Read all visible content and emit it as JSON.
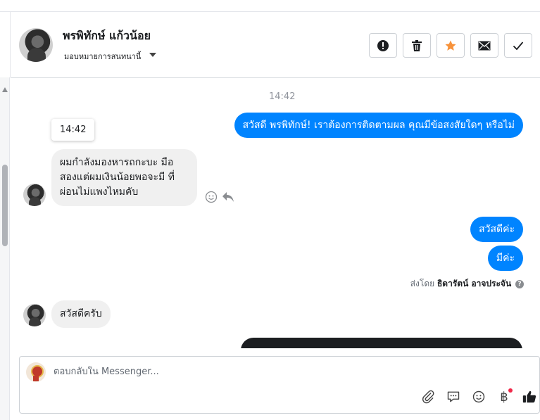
{
  "header": {
    "contact_name": "พรพิทักษ์ แก้วน้อย",
    "assign_label": "มอบหมายการสนทนานี้",
    "buttons": [
      {
        "name": "spam-button",
        "icon": "exclamation-circle-icon"
      },
      {
        "name": "delete-button",
        "icon": "trash-icon"
      },
      {
        "name": "star-button",
        "icon": "star-icon",
        "color": "#f7923b"
      },
      {
        "name": "mark-unread-button",
        "icon": "envelope-icon"
      },
      {
        "name": "mark-done-button",
        "icon": "checkmark-icon"
      }
    ]
  },
  "chat": {
    "timestamp": "14:42",
    "hover_tooltip": "14:42",
    "messages": [
      {
        "from": "page",
        "text": "สวัสดี พรพิทักษ์! เราต้องการติดตามผล คุณมีข้อสงสัยใดๆ หรือไม่"
      },
      {
        "from": "user",
        "text": "ผมกำลังมองหารถกะบะ มือสองแต่ผมเงินน้อยพอจะมี ที่ผ่อนไม่แพงไหมคับ"
      },
      {
        "from": "page",
        "text": "สวัสดีค่ะ"
      },
      {
        "from": "page",
        "text": "มีค่ะ"
      },
      {
        "from": "user",
        "text": "สวัสดีครับ"
      }
    ],
    "sent_by_prefix": "ส่งโดย",
    "sent_by_name": "ธิดารัตน์ อาจประจัน",
    "help_icon": "?"
  },
  "composer": {
    "placeholder": "ตอบกลับใน Messenger...",
    "icons": [
      "paperclip-icon",
      "speech-bubble-icon",
      "emoji-icon",
      "baht-payment-icon",
      "thumbs-up-icon"
    ],
    "baht_symbol": "฿"
  },
  "colors": {
    "accent": "#0084ff",
    "incoming_bubble": "#f0f0f0",
    "star": "#f7923b"
  }
}
